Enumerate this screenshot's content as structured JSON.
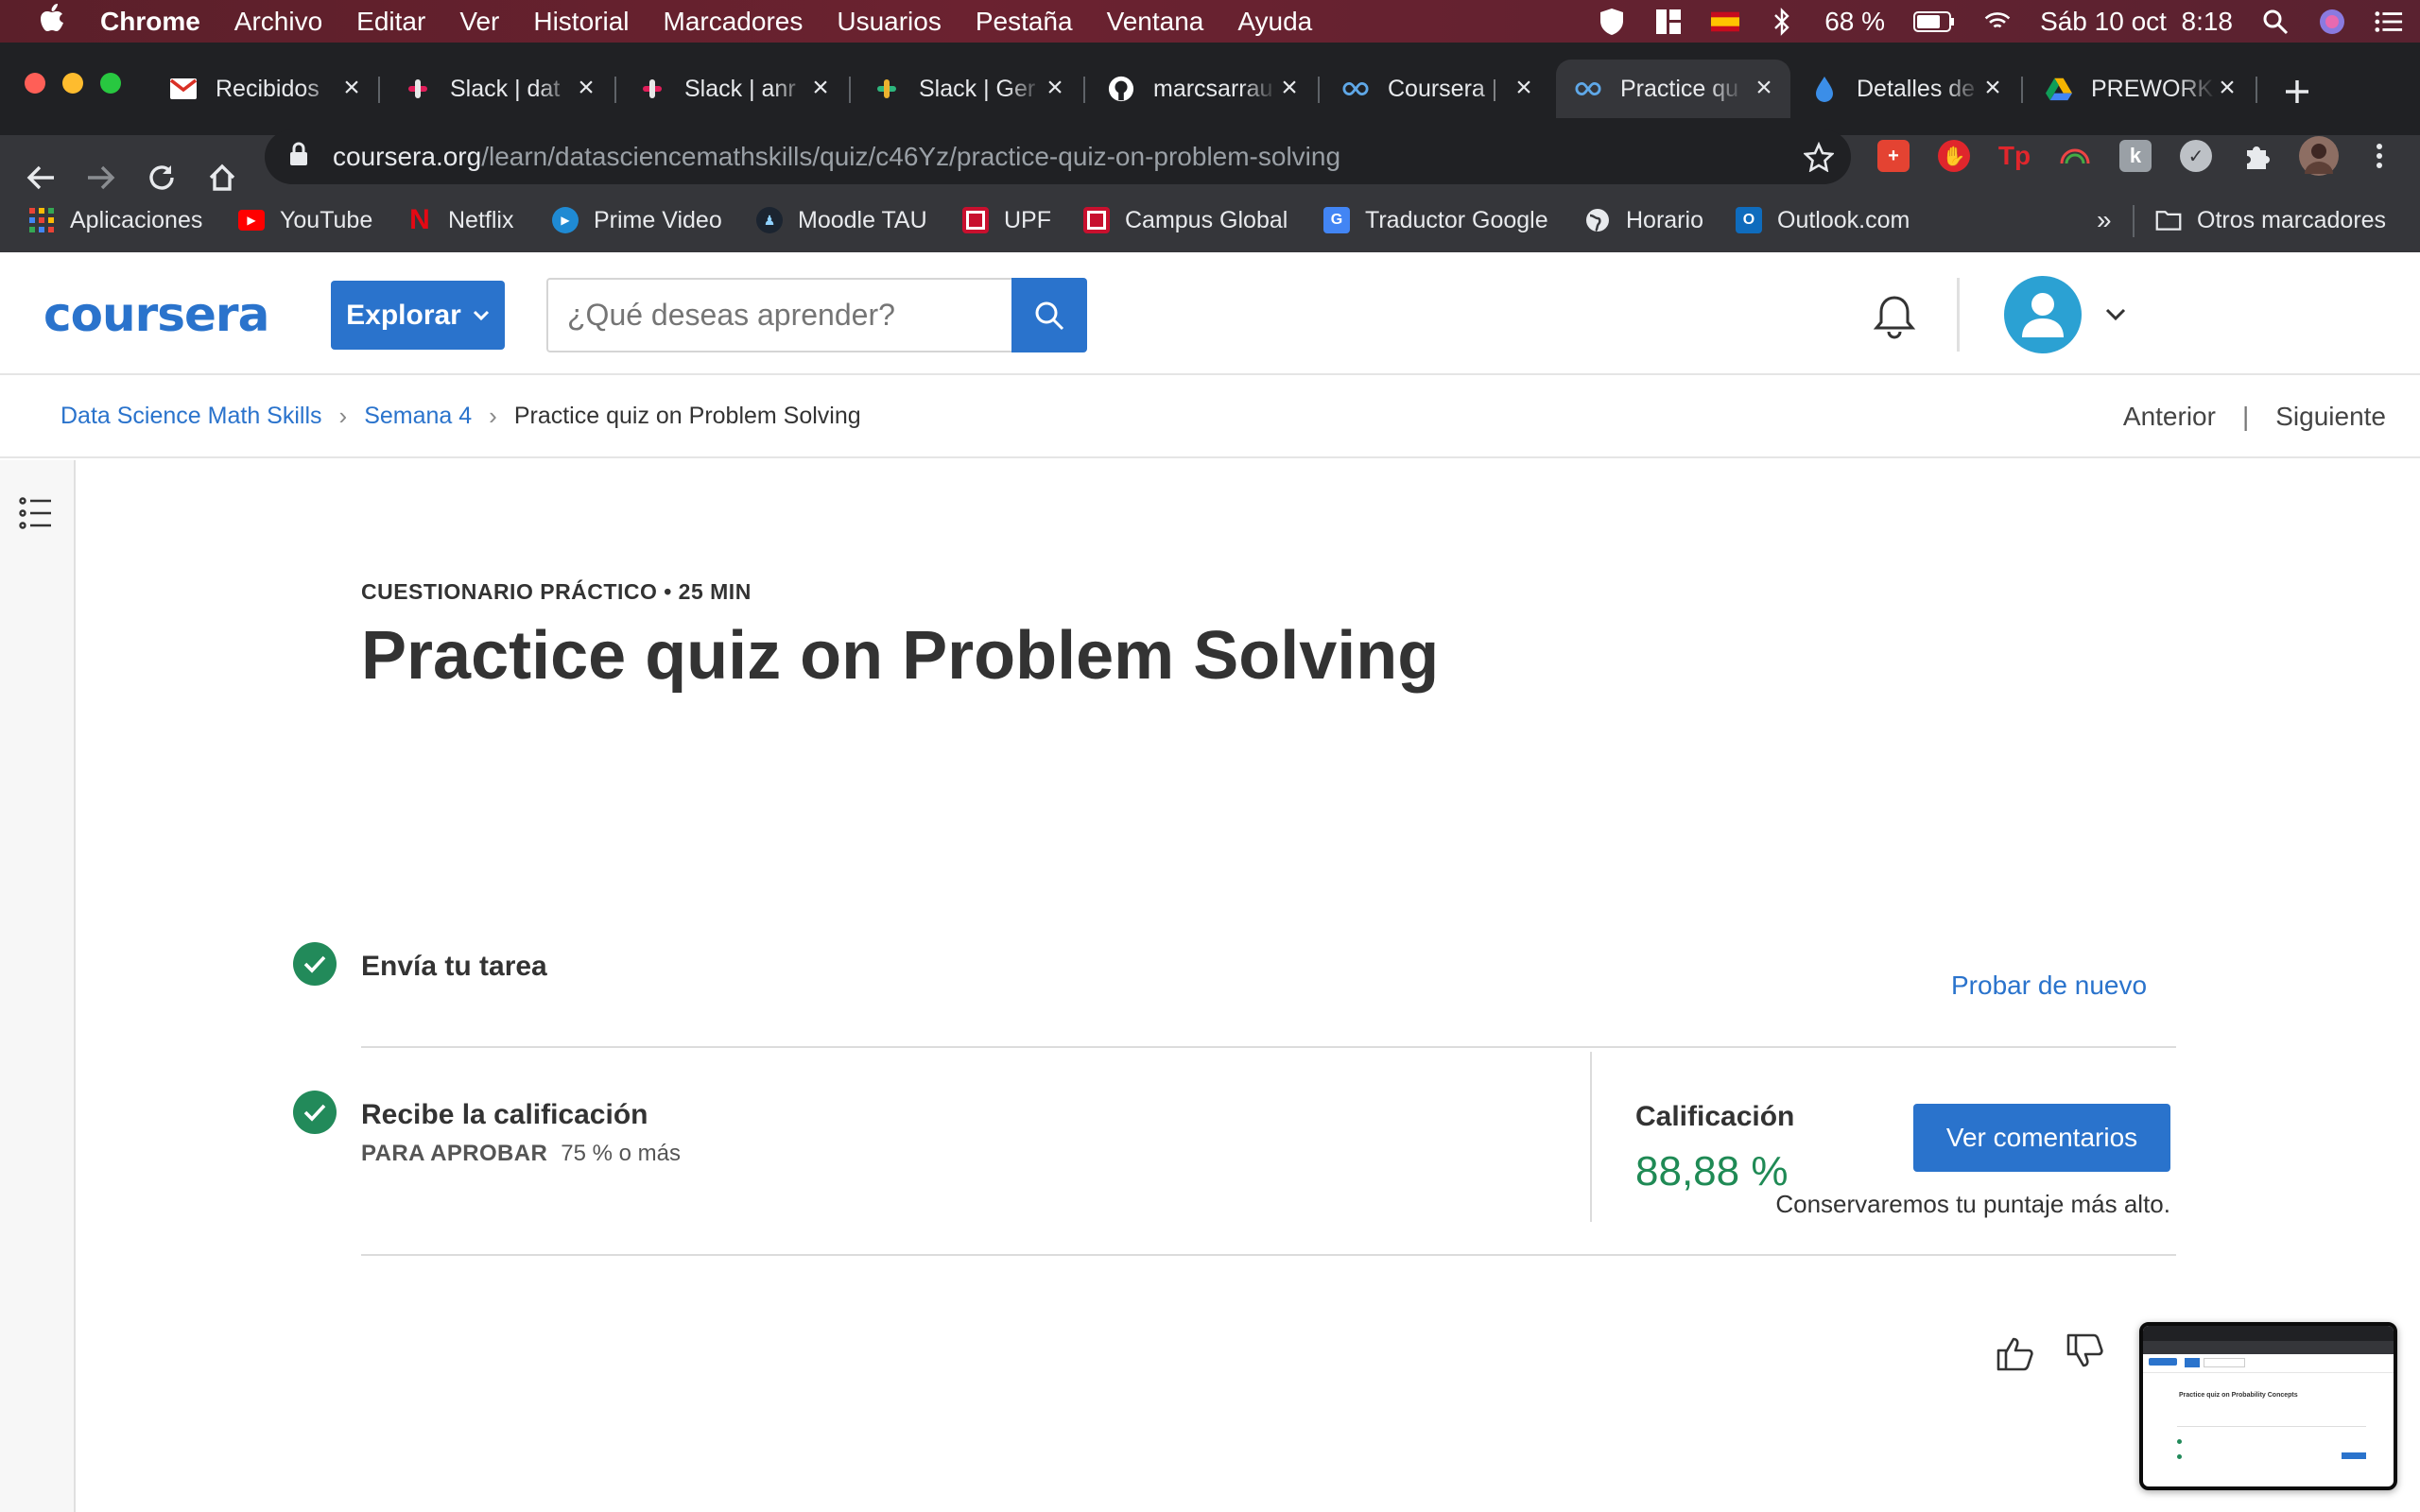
{
  "menubar": {
    "app": "Chrome",
    "items": [
      "Archivo",
      "Editar",
      "Ver",
      "Historial",
      "Marcadores",
      "Usuarios",
      "Pestaña",
      "Ventana",
      "Ayuda"
    ],
    "battery": "68 %",
    "datetime": "Sáb 10 oct  8:18"
  },
  "tabs": [
    {
      "title": "Recibidos",
      "icon": "gmail-icon",
      "color": "#d93025"
    },
    {
      "title": "Slack | dat",
      "icon": "slack-icon",
      "color": "#e01e5a"
    },
    {
      "title": "Slack | anr",
      "icon": "slack-icon",
      "color": "#e01e5a"
    },
    {
      "title": "Slack | Ger",
      "icon": "slack-icon",
      "color": "#2eb67d"
    },
    {
      "title": "marcsarrau",
      "icon": "github-icon",
      "color": "#ffffff"
    },
    {
      "title": "Coursera |",
      "icon": "coursera-icon",
      "color": "#5fa8e8"
    },
    {
      "title": "Practice qu",
      "icon": "coursera-icon",
      "color": "#5fa8e8",
      "active": true
    },
    {
      "title": "Detalles de",
      "icon": "drop-icon",
      "color": "#3b8ee8"
    },
    {
      "title": "PREWORK",
      "icon": "drive-icon",
      "color": "#f4b400"
    }
  ],
  "address": {
    "host": "coursera.org",
    "path": "/learn/datasciencemathskills/quiz/c46Yz/practice-quiz-on-problem-solving"
  },
  "bookmarks": [
    {
      "label": "Aplicaciones",
      "icon": "apps-grid-icon"
    },
    {
      "label": "YouTube",
      "icon": "youtube-icon"
    },
    {
      "label": "Netflix",
      "icon": "netflix-icon"
    },
    {
      "label": "Prime Video",
      "icon": "prime-video-icon"
    },
    {
      "label": "Moodle TAU",
      "icon": "moodle-icon"
    },
    {
      "label": "UPF",
      "icon": "upf-icon"
    },
    {
      "label": "Campus Global",
      "icon": "campus-icon"
    },
    {
      "label": "Traductor Google",
      "icon": "translate-icon"
    },
    {
      "label": "Horario",
      "icon": "globe-icon"
    },
    {
      "label": "Outlook.com",
      "icon": "outlook-icon"
    }
  ],
  "bookmarks_overflow": "»",
  "other_bookmarks": "Otros marcadores",
  "coursera": {
    "logo": "coursera",
    "explore": "Explorar",
    "search_placeholder": "¿Qué deseas aprender?"
  },
  "breadcrumb": [
    "Data Science Math Skills",
    "Semana 4",
    "Practice quiz on Problem Solving"
  ],
  "nav": {
    "prev": "Anterior",
    "sep": "|",
    "next": "Siguiente"
  },
  "quiz": {
    "kicker": "CUESTIONARIO PRÁCTICO • 25 MIN",
    "title": "Practice quiz on Problem Solving",
    "step1": "Envía tu tarea",
    "retry": "Probar de nuevo",
    "step2": "Recibe la calificación",
    "pass_label": "PARA APROBAR",
    "pass_value": "75 % o más",
    "grade_label": "Calificación",
    "grade_value": "88,88 %",
    "feedback_button": "Ver comentarios",
    "keep_note": "Conservaremos tu puntaje más alto."
  },
  "preview_thumb": {
    "title": "Practice quiz on Probability Concepts"
  },
  "colors": {
    "accent": "#2a73cc",
    "success": "#228a5a",
    "grade": "#1f8a55"
  }
}
